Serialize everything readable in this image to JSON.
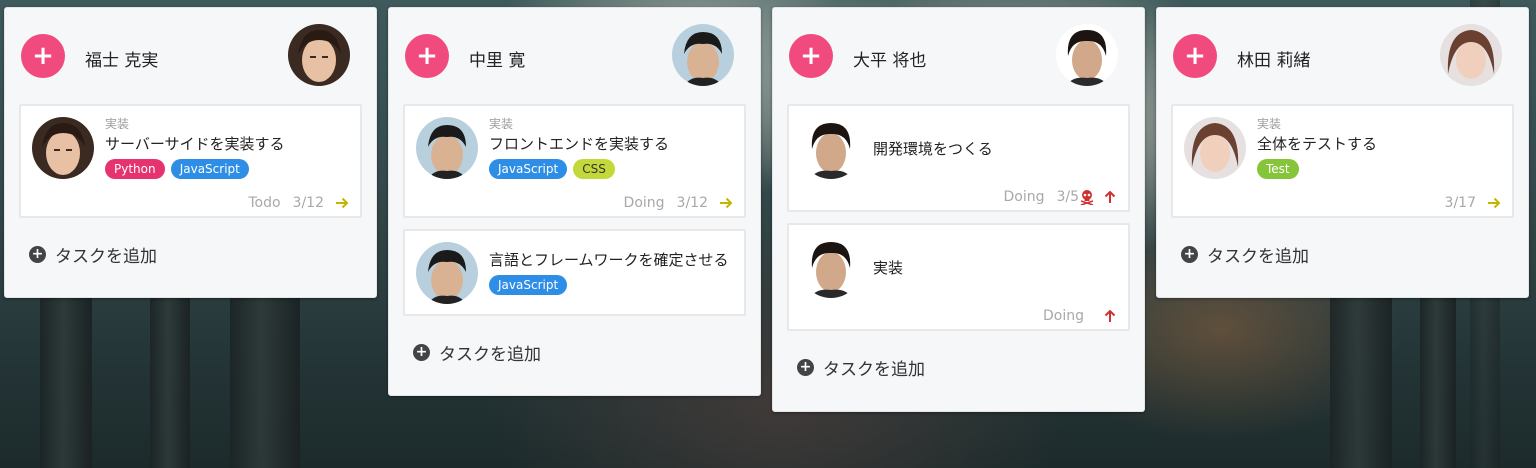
{
  "columns": [
    {
      "member": "福士 克実",
      "cards": [
        {
          "category": "実装",
          "title": "サーバーサイドを実装する",
          "tags": [
            "Python",
            "JavaScript"
          ],
          "status": "Todo",
          "due": "3/12",
          "icon": "arrow-right-icon"
        }
      ],
      "add_task_label": "タスクを追加"
    },
    {
      "member": "中里 寛",
      "cards": [
        {
          "category": "実装",
          "title": "フロントエンドを実装する",
          "tags": [
            "JavaScript",
            "CSS"
          ],
          "status": "Doing",
          "due": "3/12",
          "icon": "arrow-right-icon"
        },
        {
          "category": "",
          "title": "言語とフレームワークを確定させる",
          "tags": [
            "JavaScript"
          ],
          "status": "",
          "due": "",
          "icon": ""
        }
      ],
      "add_task_label": "タスクを追加"
    },
    {
      "member": "大平 将也",
      "cards": [
        {
          "category": "",
          "title": "開発環境をつくる",
          "tags": [],
          "status": "Doing",
          "due": "3/5",
          "icon": "arrow-up-icon",
          "overdue": "skull-icon"
        },
        {
          "category": "",
          "title": "実装",
          "tags": [],
          "status": "Doing",
          "due": "",
          "icon": "arrow-up-icon"
        }
      ],
      "add_task_label": "タスクを追加"
    },
    {
      "member": "林田 莉緒",
      "cards": [
        {
          "category": "実装",
          "title": "全体をテストする",
          "tags": [
            "Test"
          ],
          "status": "",
          "due": "3/17",
          "icon": "arrow-right-icon"
        }
      ],
      "add_task_label": "タスクを追加"
    }
  ],
  "colors": {
    "add_member_button": "#f04a7e",
    "arrow_right": "#c8b400",
    "arrow_up": "#d03030",
    "tag_python": "#e6326e",
    "tag_javascript": "#2e8ee6",
    "tag_css": "#c3d93a",
    "tag_test": "#86c53a"
  }
}
